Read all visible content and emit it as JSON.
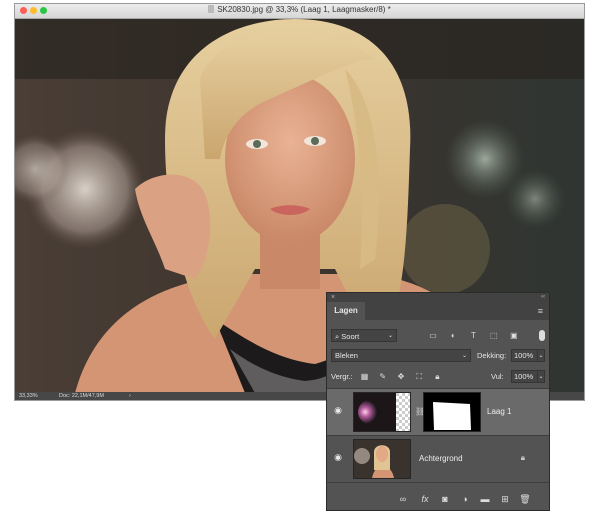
{
  "window": {
    "title": "SK20830.jpg @ 33,3% (Laag 1, Laagmasker/8) *"
  },
  "status": {
    "zoom": "33,33%",
    "doc": "Doc: 22,1M/47,9M",
    "arrow": "›"
  },
  "panel": {
    "close_glyph": "×",
    "collapse_glyph": "‹‹",
    "tab": "Lagen",
    "menu_glyph": "≡",
    "filter": {
      "kind": "Soort",
      "search_glyph": "⌕",
      "icons": [
        "image-filter-icon",
        "adjustment-filter-icon",
        "type-filter-icon",
        "shape-filter-icon",
        "smartobject-filter-icon"
      ]
    },
    "blend_mode": "Bleken",
    "opacity_label": "Dekking:",
    "opacity_value": "100%",
    "lock_label": "Vergr.:",
    "fill_label": "Vul:",
    "fill_value": "100%",
    "layers": [
      {
        "name": "Laag 1",
        "visible": true,
        "selected": true
      },
      {
        "name": "Achtergrond",
        "visible": true,
        "locked": true
      }
    ],
    "bottom_buttons": [
      "link-layers-icon",
      "fx-icon",
      "add-mask-icon",
      "adjustment-layer-icon",
      "new-group-icon",
      "new-layer-icon",
      "delete-layer-icon"
    ]
  },
  "colors": {
    "panel_bg": "#535353",
    "panel_dark": "#424242",
    "selected_layer": "#6a6a6a"
  }
}
